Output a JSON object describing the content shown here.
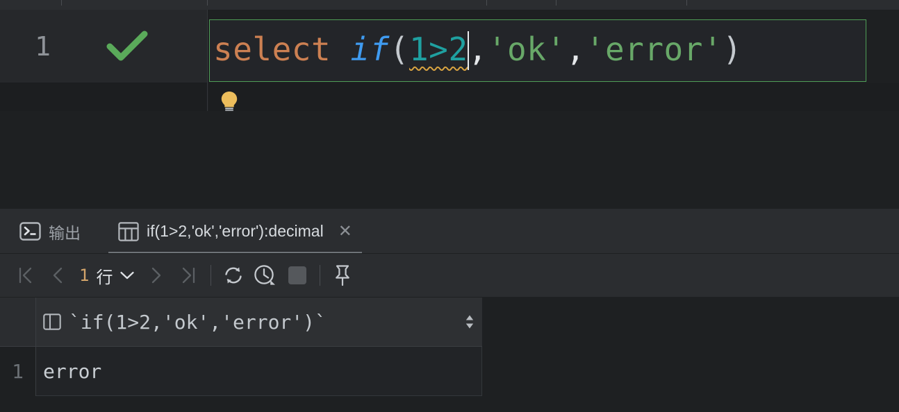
{
  "window": {
    "theme": "dark",
    "accent_green": "#4f9e57",
    "accent_orange": "#cc8052",
    "accent_blue": "#3f9bf0",
    "accent_teal": "#1fa0a0",
    "accent_string_green": "#68a868",
    "warning_yellow": "#d9a441",
    "panel_bg": "#2b2d30",
    "editor_bg": "#1e2022"
  },
  "top_toolbar": {
    "clipped": true,
    "icons": [
      "run-icon",
      "stop-icon",
      "rerun-icon",
      "profile-icon",
      "commit-icon",
      "layout-icon",
      "settings-icon",
      "console-icon"
    ]
  },
  "editor": {
    "line_number": "1",
    "status_icon": "green-checkmark-icon",
    "intention_icon": "lightbulb-icon",
    "caret_visible": true,
    "code_full": "select if(1>2,'ok','error')",
    "tokens": [
      {
        "text": "select",
        "type": "keyword"
      },
      {
        "text": " ",
        "type": "plain"
      },
      {
        "text": "if",
        "type": "function"
      },
      {
        "text": "(",
        "type": "paren"
      },
      {
        "text": "1>2",
        "type": "number-warning"
      },
      {
        "text": ",",
        "type": "punct"
      },
      {
        "text": "'ok'",
        "type": "string"
      },
      {
        "text": ",",
        "type": "punct"
      },
      {
        "text": "'error'",
        "type": "string"
      },
      {
        "text": ")",
        "type": "paren"
      }
    ]
  },
  "tabs": [
    {
      "id": "output",
      "label": "输出",
      "icon": "terminal-icon",
      "active": false,
      "closable": false
    },
    {
      "id": "result",
      "label": "if(1>2,'ok','error'):decimal",
      "icon": "table-grid-icon",
      "active": true,
      "closable": true,
      "close_label": "✕"
    }
  ],
  "grid_toolbar": {
    "first_page_label": "|<",
    "prev_page_label": "<",
    "rows_count": "1",
    "rows_unit": "行",
    "rows_dropdown_icon": "chevron-down-icon",
    "next_page_label": ">",
    "last_page_label": ">|",
    "buttons": [
      {
        "name": "refresh-button",
        "icon": "refresh-icon",
        "enabled": true
      },
      {
        "name": "history-button",
        "icon": "clock-icon",
        "enabled": true
      },
      {
        "name": "stop-button",
        "icon": "stop-square-icon",
        "enabled": false
      },
      {
        "name": "pin-button",
        "icon": "pin-icon",
        "enabled": true
      }
    ]
  },
  "result_grid": {
    "column_icon": "column-type-icon",
    "column_name": "`if(1>2,'ok','error')`",
    "sort_icon": "sort-updown-icon",
    "rows": [
      {
        "number": "1",
        "value": "error"
      }
    ]
  }
}
